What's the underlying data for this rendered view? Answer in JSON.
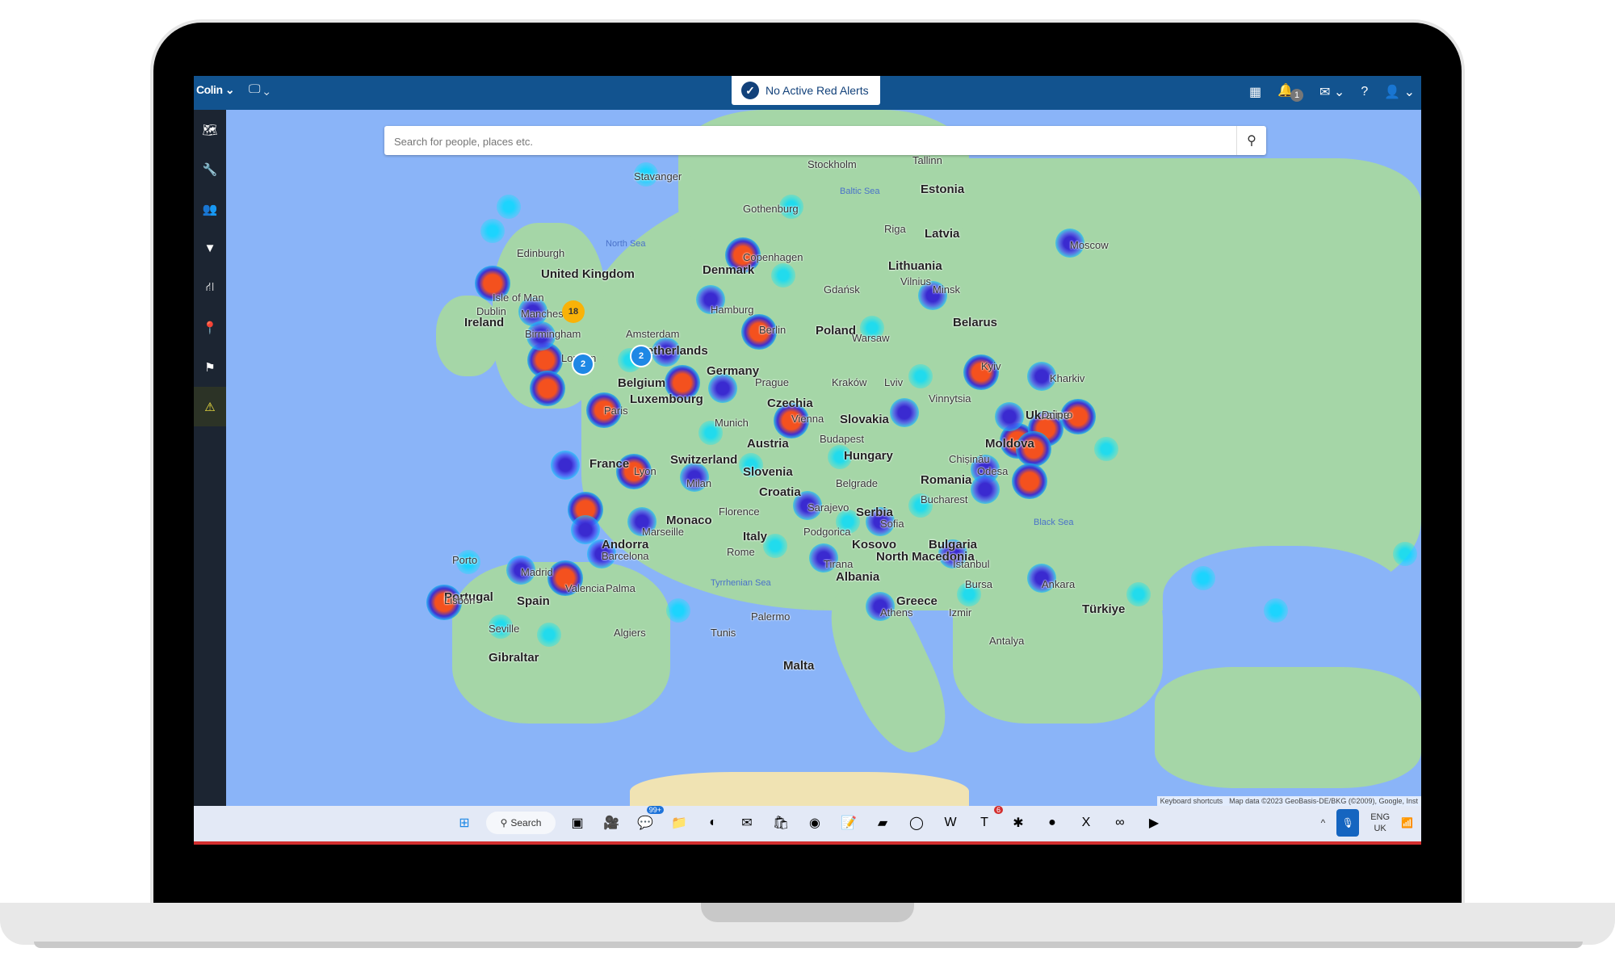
{
  "app": {
    "user_menu_label": "Colin",
    "display_menu_icon": "monitor-icon",
    "alert_status": "No Active Red Alerts",
    "notification_count": "1",
    "top_icons": [
      "apps-grid-icon",
      "bell-icon",
      "mail-icon",
      "help-icon",
      "user-icon"
    ]
  },
  "sidebar": {
    "items": [
      {
        "icon": "map-icon",
        "active": false
      },
      {
        "icon": "wrench-icon",
        "active": false
      },
      {
        "icon": "users-icon",
        "active": false
      },
      {
        "icon": "filter-icon",
        "active": false
      },
      {
        "icon": "road-icon",
        "active": false
      },
      {
        "icon": "map-pin-icon",
        "active": false
      },
      {
        "icon": "route-icon",
        "active": false
      },
      {
        "icon": "warning-icon",
        "active": true
      }
    ]
  },
  "search": {
    "placeholder": "Search for people, places etc.",
    "value": ""
  },
  "map": {
    "attribution": {
      "shortcuts": "Keyboard shortcuts",
      "data": "Map data ©2023 GeoBasis-DE/BKG (©2009), Google, Inst"
    },
    "clusters": [
      {
        "count": "18",
        "color": "#f9b208",
        "near": "United Kingdom"
      },
      {
        "count": "2",
        "color": "#1e88e5",
        "near": "London"
      },
      {
        "count": "2",
        "color": "#1e88e5",
        "near": "Netherlands"
      }
    ],
    "country_labels": [
      "United Kingdom",
      "Ireland",
      "Denmark",
      "Estonia",
      "Latvia",
      "Lithuania",
      "Belarus",
      "Poland",
      "Germany",
      "Netherlands",
      "Belgium",
      "Luxembourg",
      "France",
      "Switzerland",
      "Czechia",
      "Slovakia",
      "Austria",
      "Hungary",
      "Slovenia",
      "Croatia",
      "Ukraine",
      "Moldova",
      "Romania",
      "Serbia",
      "Bulgaria",
      "Kosovo",
      "North Macedonia",
      "Albania",
      "Greece",
      "Italy",
      "Monaco",
      "Andorra",
      "Spain",
      "Portugal",
      "Türkiye",
      "Malta",
      "Gibraltar"
    ],
    "city_labels": [
      "Edinburgh",
      "Isle of Man",
      "Dublin",
      "Manchester",
      "Birmingham",
      "London",
      "Stavanger",
      "Gothenburg",
      "Stockholm",
      "Tallinn",
      "Riga",
      "Copenhagen",
      "Hamburg",
      "Amsterdam",
      "Berlin",
      "Gdańsk",
      "Vilnius",
      "Minsk",
      "Moscow",
      "Warsaw",
      "Prague",
      "Kraków",
      "Lviv",
      "Kyiv",
      "Kharkiv",
      "Vinnytsia",
      "Dnipro",
      "Chișinău",
      "Odesa",
      "Paris",
      "Lyon",
      "Munich",
      "Vienna",
      "Budapest",
      "Milan",
      "Marseille",
      "Florence",
      "Rome",
      "Belgrade",
      "Sarajevo",
      "Podgorica",
      "Sofia",
      "Tirana",
      "Bucharest",
      "Istanbul",
      "Bursa",
      "Ankara",
      "Izmir",
      "Athens",
      "Antalya",
      "Barcelona",
      "Madrid",
      "Valencia",
      "Palma",
      "Porto",
      "Lisbon",
      "Seville",
      "Algiers",
      "Tunis",
      "Palermo"
    ],
    "sea_labels": [
      "North Sea",
      "Baltic Sea",
      "Black Sea",
      "Tyrrhenian Sea"
    ]
  },
  "taskbar": {
    "search_label": "Search",
    "chat_badge": "99+",
    "teams_badge": "6",
    "apps": [
      "windows-start-icon",
      "task-view-icon",
      "meet-icon",
      "chat-icon",
      "file-explorer-icon",
      "edge-icon",
      "outlook-icon",
      "store-icon",
      "chrome-icon",
      "notepad-icon",
      "sticky-notes-icon",
      "obs-icon",
      "word-icon",
      "teams-icon",
      "slack-icon",
      "github-icon",
      "excel-icon",
      "copilot-icon",
      "media-player-icon"
    ],
    "language_line1": "ENG",
    "language_line2": "UK"
  }
}
